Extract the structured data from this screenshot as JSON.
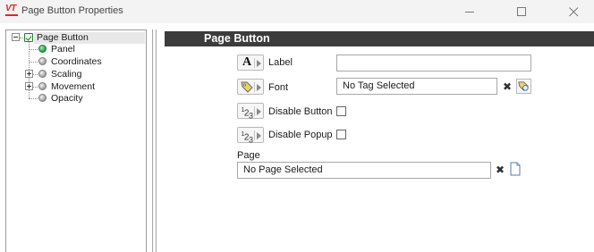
{
  "window": {
    "title": "Page Button Properties",
    "logo_text": "VT",
    "controls": {
      "minimize": "minimize-icon",
      "maximize": "maximize-icon",
      "close": "close-icon"
    }
  },
  "tree": {
    "root": {
      "label": "Page Button",
      "expanded": true
    },
    "children": [
      {
        "label": "Panel",
        "icon": "green-node-icon",
        "expandable": false
      },
      {
        "label": "Coordinates",
        "icon": "grey-node-icon",
        "expandable": false
      },
      {
        "label": "Scaling",
        "icon": "grey-node-icon",
        "expandable": true
      },
      {
        "label": "Movement",
        "icon": "grey-node-icon",
        "expandable": true
      },
      {
        "label": "Opacity",
        "icon": "grey-node-icon",
        "expandable": false
      }
    ]
  },
  "properties": {
    "section_title": "Page Button",
    "label_row": {
      "label": "Label",
      "value": ""
    },
    "font_row": {
      "label": "Font",
      "value": "No Tag Selected"
    },
    "disable_button_row": {
      "label": "Disable Button",
      "checked": false
    },
    "disable_popup_row": {
      "label": "Disable Popup",
      "checked": false
    },
    "page": {
      "heading": "Page",
      "value": "No Page Selected"
    }
  },
  "colors": {
    "header_bg": "#3c3c3c",
    "accent_red": "#d42a2a",
    "tag_yellow": "#e9d36a",
    "node_green": "#1f9a45"
  }
}
